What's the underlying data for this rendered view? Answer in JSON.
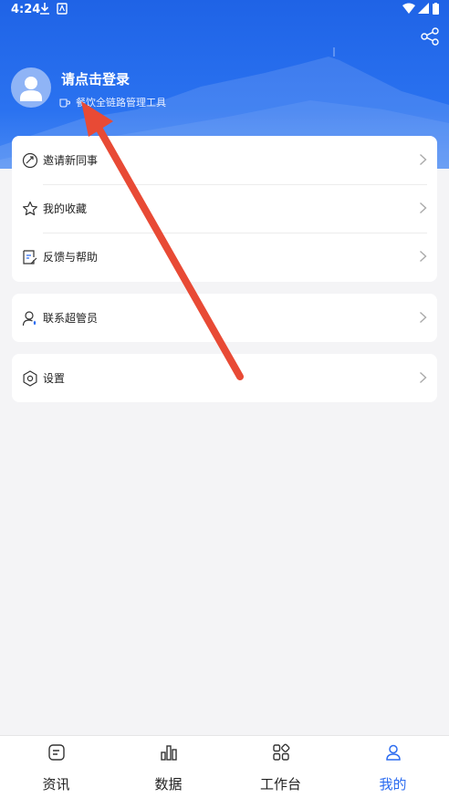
{
  "status_bar": {
    "time": "4:24"
  },
  "profile": {
    "login_prompt": "请点击登录",
    "tagline": "餐饮全链路管理工具"
  },
  "menu_groups": [
    {
      "items": [
        {
          "label": "邀请新同事",
          "icon": "invite-icon"
        },
        {
          "label": "我的收藏",
          "icon": "star-icon"
        },
        {
          "label": "反馈与帮助",
          "icon": "feedback-icon"
        }
      ]
    },
    {
      "items": [
        {
          "label": "联系超管员",
          "icon": "contact-admin-icon"
        }
      ]
    },
    {
      "items": [
        {
          "label": "设置",
          "icon": "gear-icon"
        }
      ]
    }
  ],
  "tabs": [
    {
      "label": "资讯",
      "icon": "news-icon"
    },
    {
      "label": "数据",
      "icon": "bar-chart-icon"
    },
    {
      "label": "工作台",
      "icon": "workbench-icon"
    },
    {
      "label": "我的",
      "icon": "user-icon",
      "active": true
    }
  ],
  "colors": {
    "primary": "#2c6cf0",
    "header_top": "#1f63e6",
    "annotation_arrow": "#e84a35"
  }
}
